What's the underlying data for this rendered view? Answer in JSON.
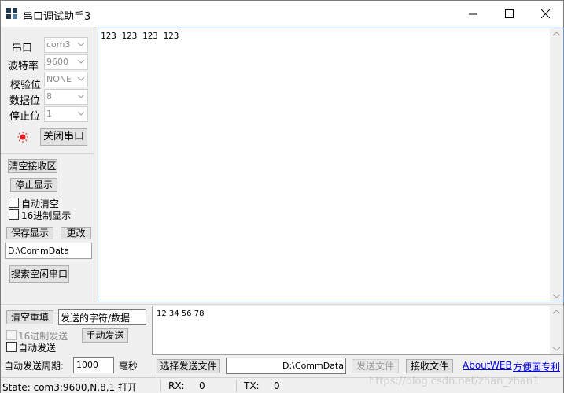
{
  "window": {
    "title": "串口调试助手3"
  },
  "settings": {
    "port_label": "串口",
    "port_value": "com3",
    "baud_label": "波特率",
    "baud_value": "9600",
    "parity_label": "校验位",
    "parity_value": "NONE",
    "databits_label": "数据位",
    "databits_value": "8",
    "stopbits_label": "停止位",
    "stopbits_value": "1",
    "close_port_label": "关闭串口"
  },
  "receive": {
    "clear_label": "清空接收区",
    "stop_display_label": "停止显示",
    "auto_clear_label": "自动清空",
    "hex_display_label": "16进制显示",
    "save_display_label": "保存显示",
    "change_label": "更改",
    "path_value": "D:\\CommData",
    "search_ports_label": "搜索空闲串口",
    "content": "123 123 123 123"
  },
  "send": {
    "reset_label": "清空重填",
    "mode_value": "发送的字符/数据",
    "hex_send_label": "16进制发送",
    "manual_send_label": "手动发送",
    "auto_send_label": "自动发送",
    "period_label": "自动发送周期:",
    "period_value": "1000",
    "period_unit": "毫秒",
    "select_file_label": "选择发送文件",
    "file_path_value": "D:\\CommData",
    "send_file_label": "发送文件",
    "receive_file_label": "接收文件",
    "content": "12 34 56 78"
  },
  "links": {
    "about": "About",
    "web": "WEB",
    "patent": "方便面专利"
  },
  "status": {
    "state_text": "State: com3:9600,N,8,1 打开",
    "rx_label": "RX:",
    "rx_value": "0",
    "tx_label": "TX:",
    "tx_value": "0"
  },
  "watermark": "https://blog.csdn.net/zhan_zhan1"
}
